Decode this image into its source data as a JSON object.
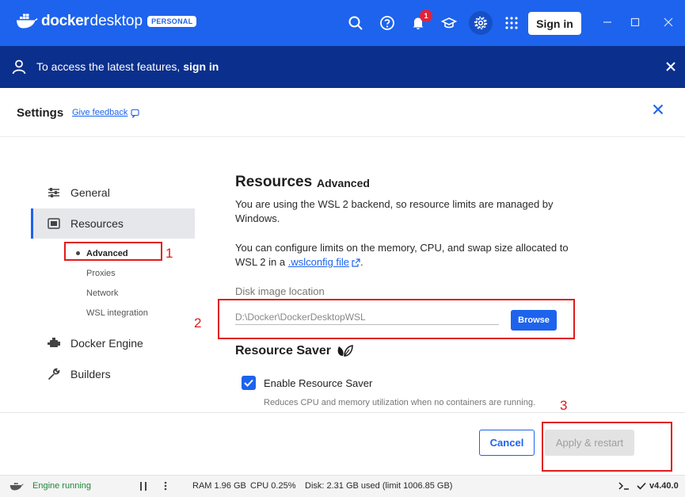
{
  "topbar": {
    "brand_bold": "docker",
    "brand_light": "desktop",
    "edition_badge": "PERSONAL",
    "notification_count": "1",
    "signin_label": "Sign in",
    "icons": [
      "search-icon",
      "help-icon",
      "bell-icon",
      "learn-icon",
      "gear-icon",
      "apps-grid-icon"
    ],
    "accent": "#1d63ed"
  },
  "banner": {
    "text": "To access the latest features,",
    "link": "sign in"
  },
  "settings": {
    "title": "Settings",
    "feedback": "Give feedback"
  },
  "sidebar": {
    "items": [
      {
        "label": "General"
      },
      {
        "label": "Resources"
      },
      {
        "label": "Docker Engine"
      },
      {
        "label": "Builders"
      }
    ],
    "subitems": [
      {
        "label": "Advanced"
      },
      {
        "label": "Proxies"
      },
      {
        "label": "Network"
      },
      {
        "label": "WSL integration"
      }
    ]
  },
  "main": {
    "title": "Resources",
    "subtitle": "Advanced",
    "para1": "You are using the WSL 2 backend, so resource limits are managed by Windows.",
    "para2_prefix": "You can configure limits on the memory, CPU, and swap size allocated to WSL 2 in a ",
    "para2_link": ".wslconfig file",
    "para2_suffix": ".",
    "disk_label": "Disk image location",
    "disk_value": "D:\\Docker\\DockerDesktopWSL",
    "browse_label": "Browse",
    "saver_title": "Resource Saver",
    "saver_checkbox_label": "Enable Resource Saver",
    "saver_checked": true,
    "saver_desc": "Reduces CPU and memory utilization when no containers are running."
  },
  "footer": {
    "cancel_label": "Cancel",
    "apply_label": "Apply & restart"
  },
  "status": {
    "engine": "Engine running",
    "ram": "RAM 1.96 GB",
    "cpu": "CPU 0.25%",
    "disk": "Disk: 2.31 GB used (limit 1006.85 GB)",
    "version": "v4.40.0"
  },
  "annotations": [
    "1",
    "2",
    "3"
  ]
}
